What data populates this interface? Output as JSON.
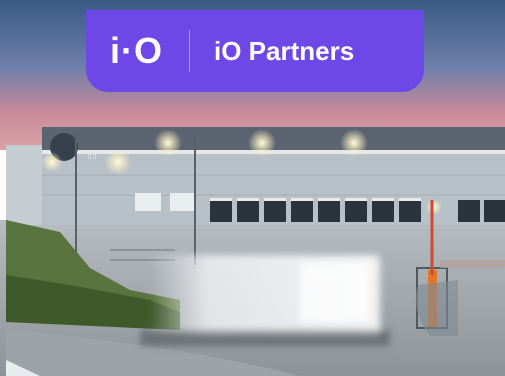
{
  "banner": {
    "logo_text": "i·O",
    "brand_name": "iO Partners",
    "background_color": "#6e48e6"
  },
  "photo": {
    "building_sign": "▯ ▯"
  }
}
